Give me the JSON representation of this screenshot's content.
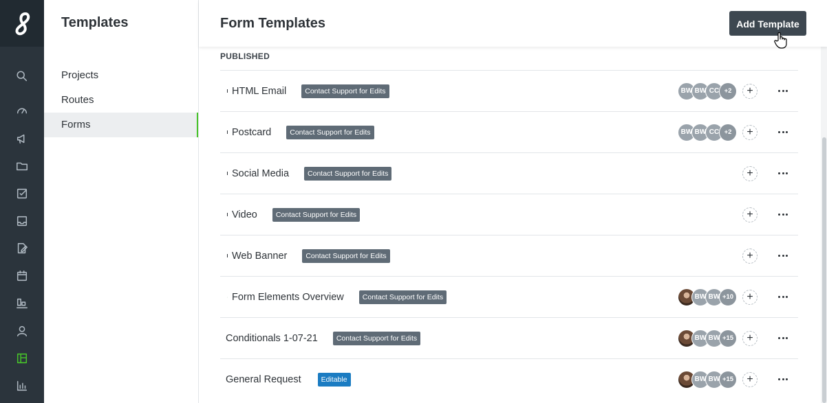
{
  "sidebar": {
    "title": "Templates",
    "items": [
      {
        "label": "Projects"
      },
      {
        "label": "Routes"
      },
      {
        "label": "Forms"
      }
    ],
    "active_item": "Forms"
  },
  "rail_icons": [
    "search-icon",
    "dashboard-icon",
    "megaphone-icon",
    "folder-icon",
    "tasks-icon",
    "inbox-icon",
    "edit-document-icon",
    "calendar-icon",
    "reports-icon",
    "user-icon",
    "templates-icon",
    "analytics-icon"
  ],
  "header": {
    "title": "Form Templates",
    "add_button": "Add Template"
  },
  "section_label": "PUBLISHED",
  "colors": {
    "accent": "#47c22a",
    "badge": "#5f6b76",
    "editable": "#1b7cc2",
    "rail": "#2b343c"
  },
  "rows": [
    {
      "name": "HTML Email",
      "badge": "Contact Support for Edits",
      "avatars": [
        "BW",
        "BW",
        "CC"
      ],
      "more": "+2"
    },
    {
      "name": "Postcard",
      "badge": "Contact Support for Edits",
      "avatars": [
        "BW",
        "BW",
        "CC"
      ],
      "more": "+2"
    },
    {
      "name": "Social Media",
      "badge": "Contact Support for Edits"
    },
    {
      "name": "Video",
      "badge": "Contact Support for Edits"
    },
    {
      "name": "Web Banner",
      "badge": "Contact Support for Edits"
    },
    {
      "name": "Form Elements Overview",
      "badge": "Contact Support for Edits",
      "avatars": [
        "BW",
        "BW"
      ],
      "more": "+10"
    },
    {
      "name": "Conditionals 1-07-21",
      "badge": "Contact Support for Edits",
      "avatars": [
        "BW",
        "BW"
      ],
      "more": "+15"
    },
    {
      "name": "General Request",
      "badge": "Editable",
      "avatars": [
        "BW",
        "BW"
      ],
      "more": "+15"
    }
  ]
}
